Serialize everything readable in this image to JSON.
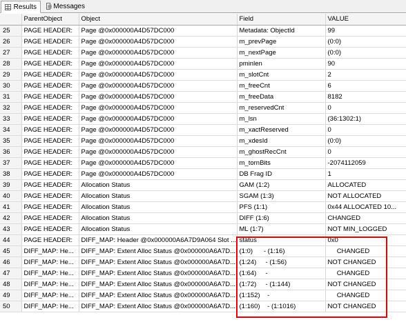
{
  "tabs": {
    "results": "Results",
    "messages": "Messages"
  },
  "columns": [
    "",
    "ParentObject",
    "Object",
    "Field",
    "VALUE"
  ],
  "rows": [
    [
      "25",
      "PAGE HEADER:",
      "Page @0x000000A4D57DC000",
      "Metadata: ObjectId",
      "99"
    ],
    [
      "26",
      "PAGE HEADER:",
      "Page @0x000000A4D57DC000",
      "m_prevPage",
      "(0:0)"
    ],
    [
      "27",
      "PAGE HEADER:",
      "Page @0x000000A4D57DC000",
      "m_nextPage",
      "(0:0)"
    ],
    [
      "28",
      "PAGE HEADER:",
      "Page @0x000000A4D57DC000",
      "pminlen",
      "90"
    ],
    [
      "29",
      "PAGE HEADER:",
      "Page @0x000000A4D57DC000",
      "m_slotCnt",
      "2"
    ],
    [
      "30",
      "PAGE HEADER:",
      "Page @0x000000A4D57DC000",
      "m_freeCnt",
      "6"
    ],
    [
      "31",
      "PAGE HEADER:",
      "Page @0x000000A4D57DC000",
      "m_freeData",
      "8182"
    ],
    [
      "32",
      "PAGE HEADER:",
      "Page @0x000000A4D57DC000",
      "m_reservedCnt",
      "0"
    ],
    [
      "33",
      "PAGE HEADER:",
      "Page @0x000000A4D57DC000",
      "m_lsn",
      "(36:1302:1)"
    ],
    [
      "34",
      "PAGE HEADER:",
      "Page @0x000000A4D57DC000",
      "m_xactReserved",
      "0"
    ],
    [
      "35",
      "PAGE HEADER:",
      "Page @0x000000A4D57DC000",
      "m_xdesId",
      "(0:0)"
    ],
    [
      "36",
      "PAGE HEADER:",
      "Page @0x000000A4D57DC000",
      "m_ghostRecCnt",
      "0"
    ],
    [
      "37",
      "PAGE HEADER:",
      "Page @0x000000A4D57DC000",
      "m_tornBits",
      "-2074112059"
    ],
    [
      "38",
      "PAGE HEADER:",
      "Page @0x000000A4D57DC000",
      "DB Frag ID",
      "1"
    ],
    [
      "39",
      "PAGE HEADER:",
      "Allocation Status",
      "GAM (1:2)",
      "ALLOCATED"
    ],
    [
      "40",
      "PAGE HEADER:",
      "Allocation Status",
      "SGAM (1:3)",
      "NOT ALLOCATED"
    ],
    [
      "41",
      "PAGE HEADER:",
      "Allocation Status",
      "PFS (1:1)",
      "0x44 ALLOCATED 10..."
    ],
    [
      "42",
      "PAGE HEADER:",
      "Allocation Status",
      "DIFF (1:6)",
      "CHANGED"
    ],
    [
      "43",
      "PAGE HEADER:",
      "Allocation Status",
      "ML (1:7)",
      "NOT MIN_LOGGED"
    ],
    [
      "44",
      "PAGE HEADER:",
      "DIFF_MAP: Header @0x000000A6A7D9A064 Slot ...",
      "status",
      "0x0"
    ],
    [
      "45",
      "DIFF_MAP: He...",
      "DIFF_MAP: Extent Alloc Status @0x000000A6A7D...",
      "(1:0)      - (1:16)",
      "     CHANGED"
    ],
    [
      "46",
      "DIFF_MAP: He...",
      "DIFF_MAP: Extent Alloc Status @0x000000A6A7D...",
      "(1:24)     - (1:56)",
      "NOT CHANGED"
    ],
    [
      "47",
      "DIFF_MAP: He...",
      "DIFF_MAP: Extent Alloc Status @0x000000A6A7D...",
      "(1:64)     -",
      "     CHANGED"
    ],
    [
      "48",
      "DIFF_MAP: He...",
      "DIFF_MAP: Extent Alloc Status @0x000000A6A7D...",
      "(1:72)     - (1:144)",
      "NOT CHANGED"
    ],
    [
      "49",
      "DIFF_MAP: He...",
      "DIFF_MAP: Extent Alloc Status @0x000000A6A7D...",
      "(1:152)    -",
      "     CHANGED"
    ],
    [
      "50",
      "DIFF_MAP: He...",
      "DIFF_MAP: Extent Alloc Status @0x000000A6A7D...",
      "(1:160)    - (1:1016)",
      "NOT CHANGED"
    ]
  ],
  "highlight_color": "#e00000"
}
